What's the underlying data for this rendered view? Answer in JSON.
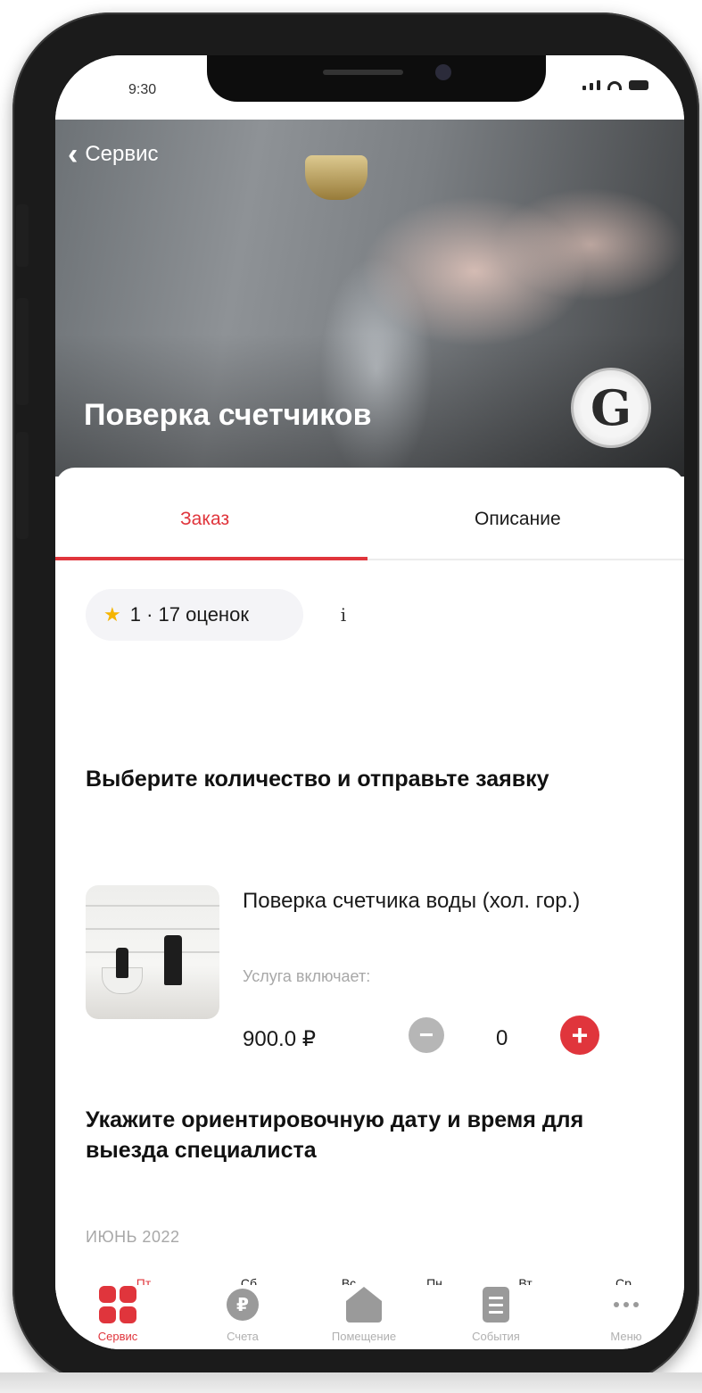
{
  "status_bar": {
    "time": "9:30"
  },
  "header": {
    "back_label": "Сервис",
    "title": "Поверка счетчиков",
    "provider_logo_letter": "G"
  },
  "tabs": [
    {
      "label": "Заказ",
      "active": true
    },
    {
      "label": "Описание",
      "active": false
    }
  ],
  "rating": {
    "text": "1 · 17 оценок",
    "info_icon": "i"
  },
  "order_section": {
    "title": "Выберите количество и отправьте заявку",
    "item": {
      "name": "Поверка счетчика воды (хол. гор.)",
      "includes_label": "Услуга включает:",
      "price": "900.0 ₽",
      "quantity": "0"
    }
  },
  "date_section": {
    "title": "Укажите ориентировочную дату и время для выезда специалиста",
    "month": "ИЮНЬ 2022",
    "days": [
      "Пт",
      "Сб",
      "Вс",
      "Пн",
      "Вт",
      "Ср"
    ],
    "active_day_index": 0
  },
  "tabbar": {
    "items": [
      {
        "label": "Сервис",
        "icon": "services-grid-icon",
        "active": true
      },
      {
        "label": "Счета",
        "icon": "ruble-coin-icon",
        "active": false
      },
      {
        "label": "Помещение",
        "icon": "house-icon",
        "active": false
      },
      {
        "label": "События",
        "icon": "document-icon",
        "active": false
      },
      {
        "label": "Меню",
        "icon": "more-dots-icon",
        "active": false
      }
    ]
  },
  "colors": {
    "accent": "#e0353c",
    "muted": "#a8a8a8",
    "chip_bg": "#f4f4f7",
    "star": "#f5b400"
  }
}
